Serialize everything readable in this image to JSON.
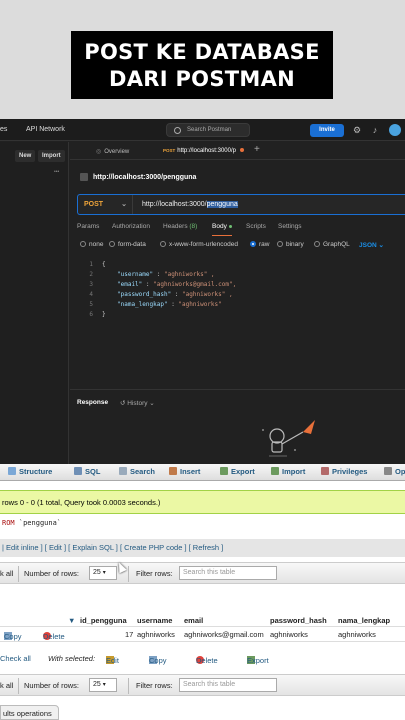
{
  "caption": {
    "line1": "POST KE DATABASE",
    "line2": "DARI POSTMAN"
  },
  "postman": {
    "top": {
      "left_partial": "es",
      "api_network": "API Network",
      "search_placeholder": "Search Postman",
      "invite": "Invite"
    },
    "sidebar": {
      "new": "New",
      "import": "Import",
      "dots": "•••"
    },
    "tabs": [
      {
        "label": "Overview"
      },
      {
        "method": "POST",
        "label": "http://localhost:3000/p"
      }
    ],
    "new_tab": "+",
    "request_name": "http://localhost:3000/pengguna",
    "method": "POST",
    "url_base": "http://localhost:3000/",
    "url_selected": "pengguna",
    "subtabs": {
      "params": "Params",
      "auth": "Authorization",
      "headers": "Headers",
      "headers_count": "(8)",
      "body": "Body",
      "scripts": "Scripts",
      "settings": "Settings"
    },
    "body_options": {
      "none": "none",
      "form_data": "form-data",
      "urlencoded": "x-www-form-urlencoded",
      "raw": "raw",
      "binary": "binary",
      "graphql": "GraphQL",
      "json": "JSON"
    },
    "code_lines": [
      {
        "n": "1",
        "text": "{"
      },
      {
        "n": "2",
        "key": "\"username\"",
        "val": "\"aghniworks\" ,"
      },
      {
        "n": "3",
        "key": "\"email\"",
        "val": "\"aghniworks@gmail.com\","
      },
      {
        "n": "4",
        "key": "\"password_hash\"",
        "val": "\"aghniworks\" ,"
      },
      {
        "n": "5",
        "key": "\"nama_lengkap\"",
        "val": "\"aghniworks\""
      },
      {
        "n": "6",
        "text": "}"
      }
    ],
    "response": {
      "label": "Response",
      "history": "History"
    }
  },
  "pma": {
    "tabs": [
      "Structure",
      "SQL",
      "Search",
      "Insert",
      "Export",
      "Import",
      "Privileges",
      "Op"
    ],
    "success": "rows 0 - 0 (1 total, Query took 0.0003 seconds.)",
    "sql": {
      "kw": "ROM",
      "table": "`pengguna`"
    },
    "links": "| Edit inline ] [ Edit ] [ Explain SQL ] [ Create PHP code ] [ Refresh ]",
    "nav": {
      "check_all": "k all",
      "rows_label": "Number of rows:",
      "rows_value": "25",
      "filter_label": "Filter rows:",
      "filter_placeholder": "Search this table"
    },
    "columns": [
      "id_pengguna",
      "username",
      "email",
      "password_hash",
      "nama_lengkap"
    ],
    "row": {
      "copy": "Copy",
      "delete": "Delete",
      "id": "17",
      "username": "aghniworks",
      "email": "aghniworks@gmail.com",
      "password_hash": "aghniworks",
      "nama_lengkap": "aghniworks"
    },
    "actions": {
      "check_all": "Check all",
      "with_selected": "With selected:",
      "edit": "Edit",
      "copy": "Copy",
      "delete": "Delete",
      "export": "Export"
    },
    "nav2": {
      "check_all": "k all",
      "rows_label": "Number of rows:",
      "rows_value": "25",
      "filter_label": "Filter rows:",
      "filter_placeholder": "Search this table"
    },
    "query_results": "ults operations"
  }
}
